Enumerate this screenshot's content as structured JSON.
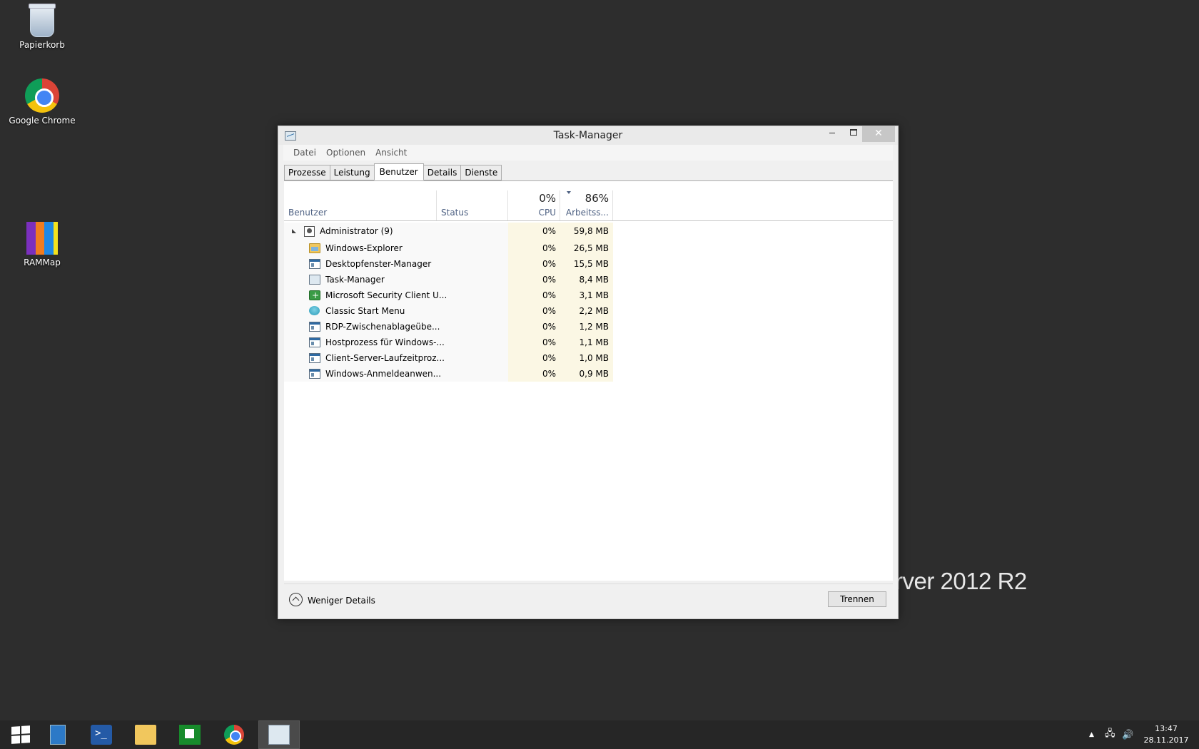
{
  "desktop": {
    "icons": [
      {
        "label": "Papierkorb"
      },
      {
        "label": "Google Chrome"
      },
      {
        "label": "RAMMap"
      }
    ],
    "watermark": "rver 2012 R2"
  },
  "window": {
    "title": "Task-Manager",
    "menu": [
      "Datei",
      "Optionen",
      "Ansicht"
    ],
    "tabs": [
      "Prozesse",
      "Leistung",
      "Benutzer",
      "Details",
      "Dienste"
    ],
    "active_tab": "Benutzer",
    "columns": {
      "user": "Benutzer",
      "status": "Status",
      "cpu_pct": "0%",
      "cpu": "CPU",
      "mem_pct": "86%",
      "mem": "Arbeitss..."
    },
    "group": {
      "name": "Administrator (9)",
      "cpu": "0%",
      "mem": "59,8 MB"
    },
    "processes": [
      {
        "name": "Windows-Explorer",
        "icon": "explorer-icon",
        "cpu": "0%",
        "mem": "26,5 MB"
      },
      {
        "name": "Desktopfenster-Manager",
        "icon": "window-app-icon",
        "cpu": "0%",
        "mem": "15,5 MB"
      },
      {
        "name": "Task-Manager",
        "icon": "task-manager-icon",
        "cpu": "0%",
        "mem": "8,4 MB"
      },
      {
        "name": "Microsoft Security Client U...",
        "icon": "security-shield-icon",
        "cpu": "0%",
        "mem": "3,1 MB"
      },
      {
        "name": "Classic Start Menu",
        "icon": "classic-start-menu-icon",
        "cpu": "0%",
        "mem": "2,2 MB"
      },
      {
        "name": "RDP-Zwischenablageübe...",
        "icon": "window-app-icon",
        "cpu": "0%",
        "mem": "1,2 MB"
      },
      {
        "name": "Hostprozess für Windows-...",
        "icon": "window-app-icon",
        "cpu": "0%",
        "mem": "1,1 MB"
      },
      {
        "name": "Client-Server-Laufzeitproz...",
        "icon": "window-app-icon",
        "cpu": "0%",
        "mem": "1,0 MB"
      },
      {
        "name": "Windows-Anmeldeanwen...",
        "icon": "window-app-icon",
        "cpu": "0%",
        "mem": "0,9 MB"
      }
    ],
    "footer": {
      "less_details": "Weniger Details",
      "disconnect": "Trennen"
    }
  },
  "taskbar": {
    "clock_time": "13:47",
    "clock_date": "28.11.2017"
  },
  "colors": {
    "desktop_bg": "#2d2d2d",
    "taskbar_bg": "#262626",
    "column_highlight": "#fbf7e4",
    "header_label": "#4d6082"
  }
}
